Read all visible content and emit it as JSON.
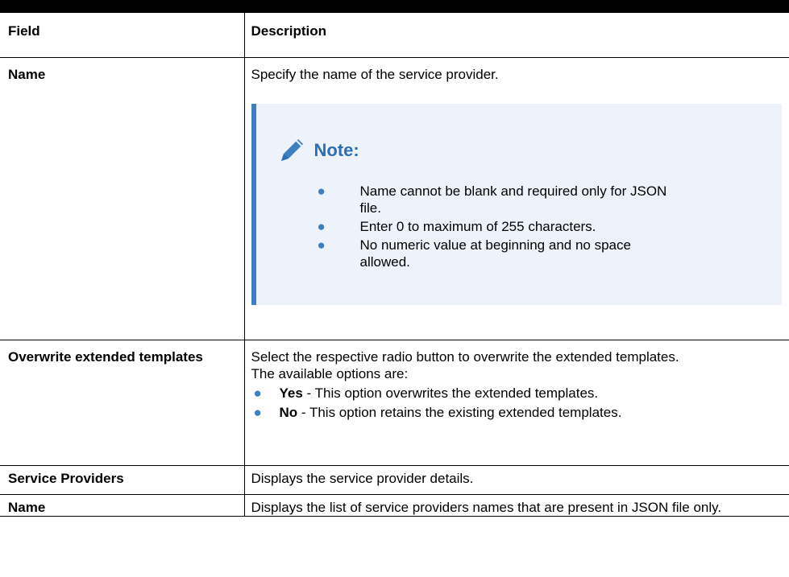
{
  "table": {
    "header": {
      "field": "Field",
      "description": "Description"
    },
    "row_name": {
      "field": "Name",
      "description": "Specify the name of the service provider.",
      "note": {
        "title": "Note:",
        "items": [
          "Name cannot be blank and required only for JSON file.",
          "Enter 0 to maximum of 255 characters.",
          "No numeric value at beginning and no space allowed."
        ]
      }
    },
    "row_overwrite": {
      "field": "Overwrite extended templates",
      "description": "Select the respective radio button to overwrite the extended templates.",
      "options_intro": "The available options are:",
      "options": [
        {
          "term": "Yes",
          "text": " - This option overwrites the extended templates."
        },
        {
          "term": "No",
          "text": " - This option retains the existing extended templates."
        }
      ]
    },
    "row_service_providers": {
      "field": "Service Providers",
      "description": "Displays the service provider details."
    },
    "row_name_list": {
      "field": "Name",
      "description": "Displays the list of service providers names that are present in JSON file only."
    }
  },
  "colors": {
    "note_accent": "#3d7fc1",
    "note_title": "#2c6fb3",
    "note_background": "#eef3fb"
  },
  "icons": {
    "note": "pencil-icon",
    "list_marker": "bullet"
  }
}
